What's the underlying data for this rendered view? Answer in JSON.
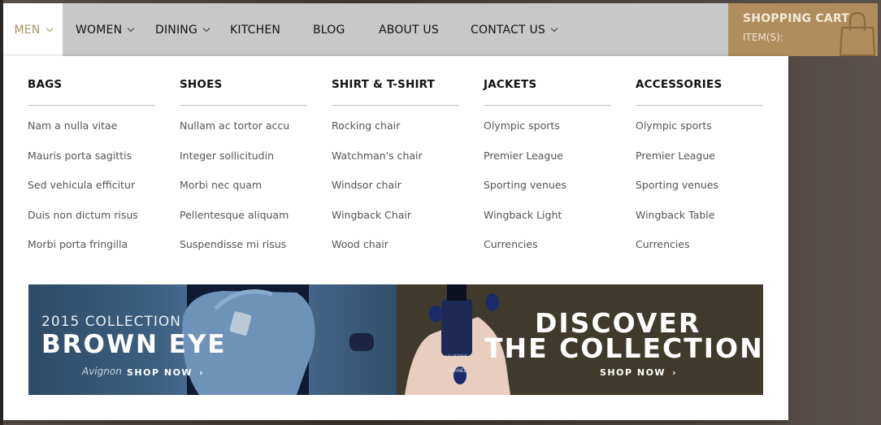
{
  "nav": {
    "items": [
      {
        "label": "MEN",
        "dropdown": true,
        "active": true
      },
      {
        "label": "WOMEN",
        "dropdown": true
      },
      {
        "label": "DINING",
        "dropdown": true
      },
      {
        "label": "KITCHEN",
        "dropdown": false
      },
      {
        "label": "BLOG",
        "dropdown": false
      },
      {
        "label": "ABOUT US",
        "dropdown": false
      },
      {
        "label": "CONTACT US",
        "dropdown": true
      }
    ]
  },
  "cart": {
    "title": "SHOPPING CART",
    "items_label": "ITEM(S):",
    "icon": "shopping-bag-icon"
  },
  "menu": {
    "columns": [
      {
        "heading": "BAGS",
        "links": [
          "Nam a nulla vitae",
          "Mauris porta sagittis",
          "Sed vehicula efficitur",
          "Duis non dictum risus",
          "Morbi porta fringilla"
        ]
      },
      {
        "heading": "SHOES",
        "links": [
          "Nullam ac tortor accu",
          "Integer sollicitudin",
          "Morbi nec quam",
          "Pellentesque aliquam",
          "Suspendisse mi risus"
        ]
      },
      {
        "heading": "SHIRT & T-SHIRT",
        "links": [
          "Rocking chair",
          "Watchman's chair",
          "Windsor chair",
          "Wingback Chair",
          "Wood chair"
        ]
      },
      {
        "heading": "JACKETS",
        "links": [
          "Olympic sports",
          "Premier League",
          "Sporting venues",
          "Wingback Light",
          "Currencies"
        ]
      },
      {
        "heading": "ACCESSORIES",
        "links": [
          "Olympic sports",
          "Premier League",
          "Sporting venues",
          "Wingback Table",
          "Currencies"
        ]
      }
    ]
  },
  "banners": {
    "left": {
      "kicker": "2015 COLLECTION",
      "title": "BROWN EYE",
      "signature": "Avignon",
      "cta": "SHOP NOW"
    },
    "right": {
      "line1": "DISCOVER",
      "line2": "THE COLLECTION",
      "cta": "SHOP NOW",
      "product_label": "CHANEL",
      "product_small": "LE VERNIS"
    }
  },
  "colors": {
    "nav_bg": "#c8c8c8",
    "active": "#b0925f",
    "cart_bg": "#b08d5c",
    "heading": "#111111",
    "link": "#555555"
  }
}
